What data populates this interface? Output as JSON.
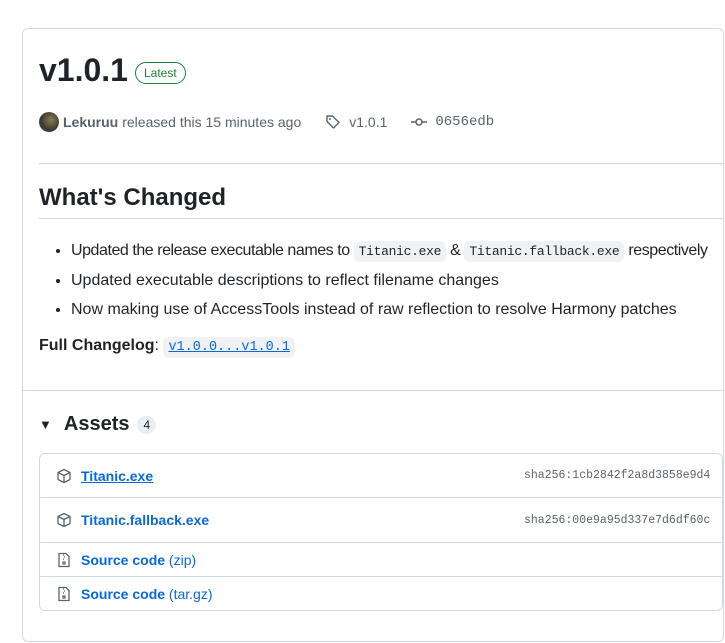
{
  "release": {
    "version": "v1.0.1",
    "badge": "Latest",
    "author": "Lekuruu",
    "released_text": "released this 15 minutes ago",
    "tag": "v1.0.1",
    "commit": "0656edb"
  },
  "changes": {
    "heading": "What's Changed",
    "item1": {
      "pre": "Updated the release executable names to ",
      "code1": "Titanic.exe",
      "mid": " & ",
      "code2": "Titanic.fallback.exe",
      "post": " respectively"
    },
    "item2": "Updated executable descriptions to reflect filename changes",
    "item3": "Now making use of AccessTools instead of raw reflection to resolve Harmony patches",
    "full_label": "Full Changelog",
    "full_sep": ": ",
    "full_link": "v1.0.0...v1.0.1"
  },
  "assets": {
    "heading": "Assets",
    "count": "4",
    "items": [
      {
        "name": "Titanic.exe",
        "sha": "sha256:1cb2842f2a8d3858e9d4"
      },
      {
        "name": "Titanic.fallback.exe",
        "sha": "sha256:00e9a95d337e7d6df60c"
      },
      {
        "name": "Source code",
        "suffix": "(zip)"
      },
      {
        "name": "Source code",
        "suffix": "(tar.gz)"
      }
    ]
  }
}
